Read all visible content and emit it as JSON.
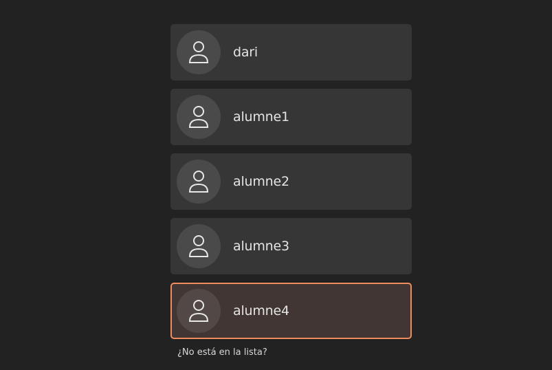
{
  "users": [
    {
      "name": "dari",
      "selected": false
    },
    {
      "name": "alumne1",
      "selected": false
    },
    {
      "name": "alumne2",
      "selected": false
    },
    {
      "name": "alumne3",
      "selected": false
    },
    {
      "name": "alumne4",
      "selected": true
    }
  ],
  "not_listed_label": "¿No está en la lista?",
  "colors": {
    "background": "#222222",
    "item_background": "#363636",
    "selected_background": "#413633",
    "selected_border": "#f08d5e"
  },
  "icons": {
    "avatar": "user-avatar-icon"
  }
}
